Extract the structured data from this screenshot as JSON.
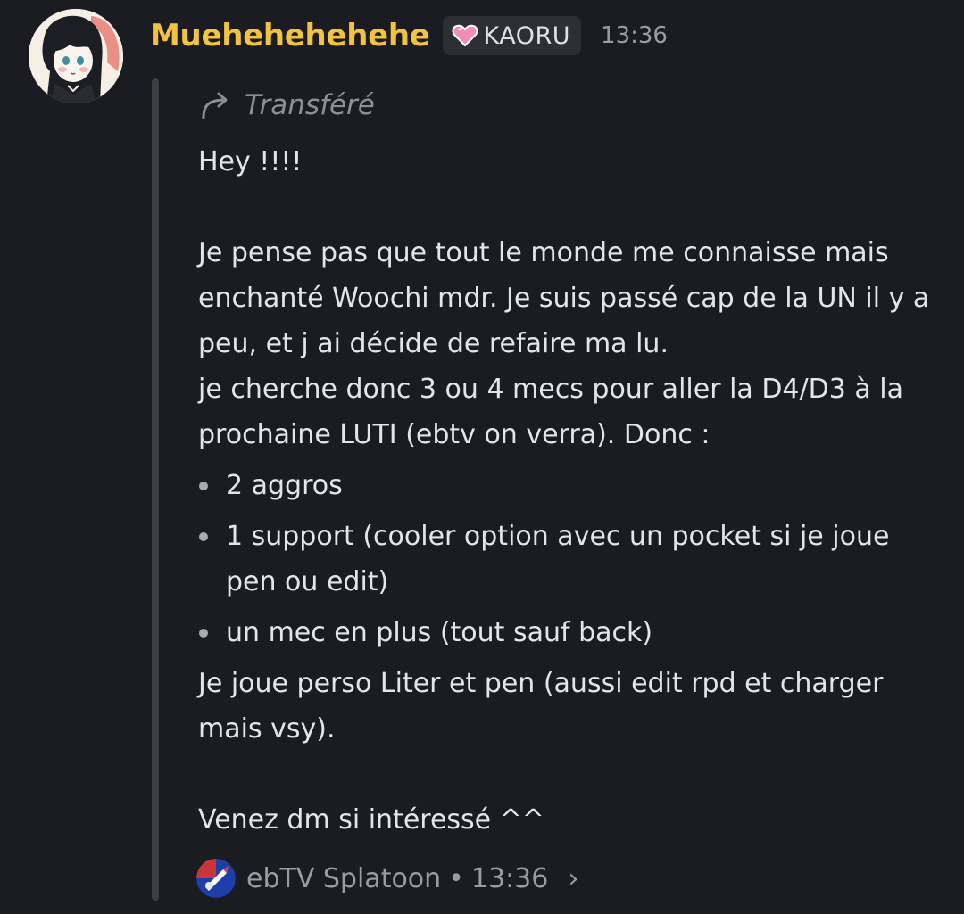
{
  "author": {
    "name": "Muehehehehehe",
    "tag": "KAORU",
    "timestamp": "13:36",
    "avatar_icon": "avatar-image",
    "tag_icon": "heart-icon",
    "colors": {
      "name": "#f2c33c",
      "background": "#1b1c22",
      "text": "#e3e5ea",
      "muted": "#9a9ca4"
    }
  },
  "forward": {
    "label": "Transféré",
    "icon": "forward-arrow-icon"
  },
  "message": {
    "greeting": "Hey !!!!",
    "para1": "Je pense pas que tout le monde me connaisse mais enchanté Woochi mdr. Je suis passé cap de la UN il y a peu, et j ai décide de refaire ma lu.",
    "para2": "je cherche donc 3 ou 4 mecs pour aller la D4/D3 à la prochaine LUTI (ebtv on verra). Donc :",
    "bullets": [
      "2 aggros",
      "1 support (cooler option avec un pocket si je joue pen ou edit)",
      "un mec en plus (tout sauf back)"
    ],
    "para3": "Je joue perso Liter et pen (aussi edit rpd et charger mais vsy).",
    "closing": "Venez dm si intéressé ^^"
  },
  "source": {
    "server": "ebTV Splatoon",
    "separator": "•",
    "time": "13:36",
    "server_icon": "server-icon",
    "chevron": "›"
  }
}
